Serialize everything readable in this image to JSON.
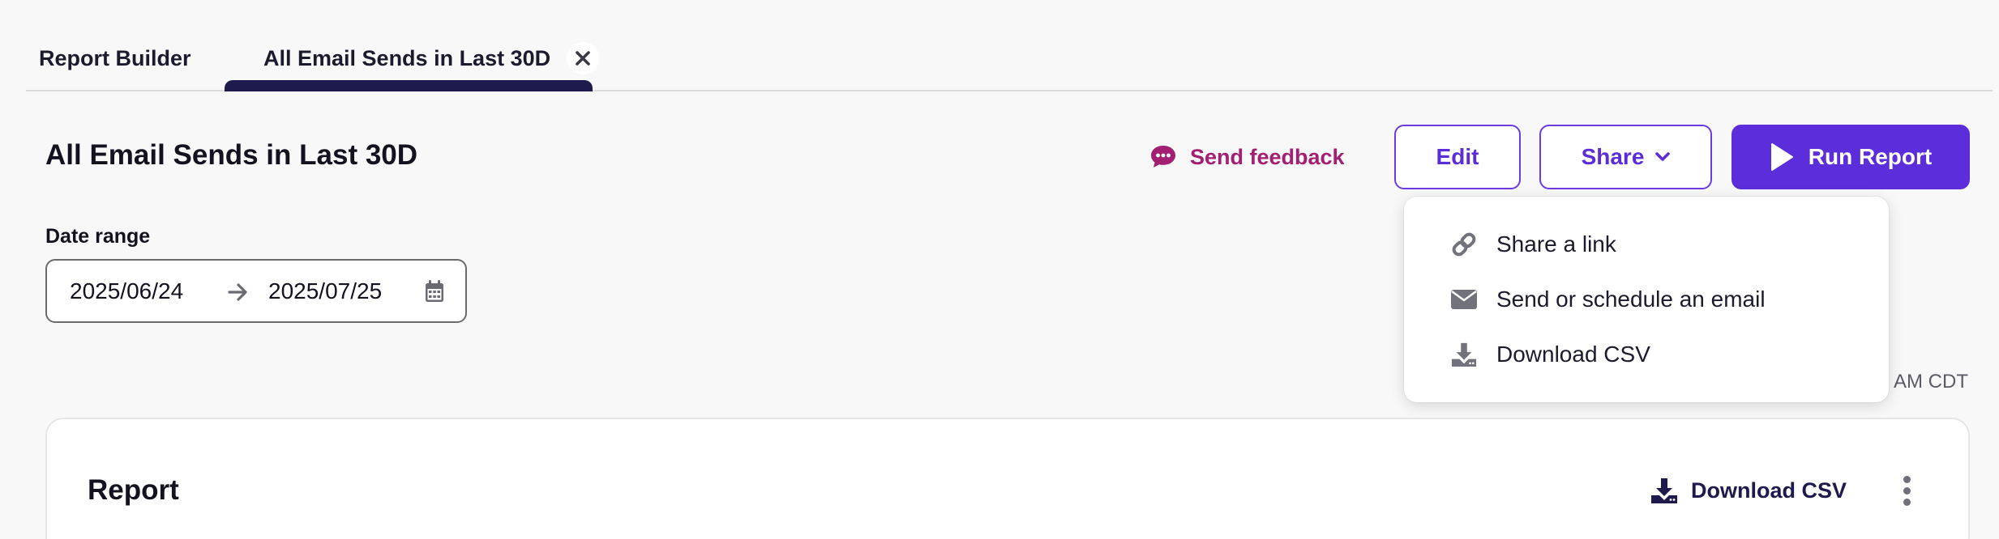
{
  "tabs": [
    {
      "label": "Report Builder"
    },
    {
      "label": "All Email Sends in Last 30D",
      "active": true
    }
  ],
  "header": {
    "title": "All Email Sends in Last 30D",
    "feedback_label": "Send feedback",
    "edit_label": "Edit",
    "share_label": "Share",
    "run_label": "Run Report"
  },
  "date_range": {
    "label": "Date range",
    "start": "2025/06/24",
    "end": "2025/07/25"
  },
  "timestamp_visible": "AM CDT",
  "share_menu": {
    "items": [
      {
        "label": "Share a link",
        "icon": "link-icon"
      },
      {
        "label": "Send or schedule an email",
        "icon": "envelope-icon"
      },
      {
        "label": "Download CSV",
        "icon": "download-icon"
      }
    ]
  },
  "report": {
    "title": "Report",
    "download_label": "Download CSV"
  },
  "colors": {
    "primary": "#5b2ddb",
    "feedback": "#a21f72",
    "tab_underline": "#1f1a4d",
    "background": "#f8f8f8"
  }
}
